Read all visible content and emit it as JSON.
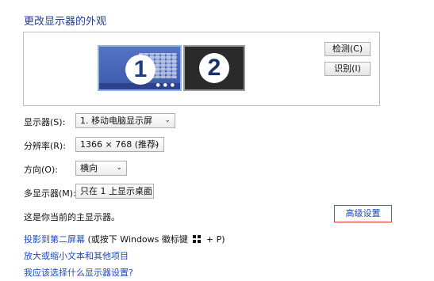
{
  "title": "更改显示器的外观",
  "preview": {
    "monitors": [
      {
        "number": "1",
        "selected": true
      },
      {
        "number": "2",
        "selected": false
      }
    ],
    "detect_label": "检测(C)",
    "identify_label": "识别(I)"
  },
  "settings": {
    "display_label": "显示器(S):",
    "display_value": "1. 移动电脑显示屏",
    "resolution_label": "分辨率(R):",
    "resolution_value": "1366 × 768 (推荐)",
    "orientation_label": "方向(O):",
    "orientation_value": "横向",
    "multi_label": "多显示器(M):",
    "multi_value": "只在 1 上显示桌面"
  },
  "info_text": "这是你当前的主显示器。",
  "advanced_label": "高级设置",
  "links": {
    "project_text": "投影到第二屏幕",
    "project_hint_pre": " (或按下 Windows 徽标键 ",
    "project_hint_post": " + P)",
    "enlarge": "放大或缩小文本和其他项目",
    "choose": "我应该选择什么显示器设置?"
  },
  "colors": {
    "link": "#1e4bb8",
    "title": "#1e3f8a",
    "highlight_border": "#e2332b",
    "monitor_selected": "#3c59ad"
  }
}
